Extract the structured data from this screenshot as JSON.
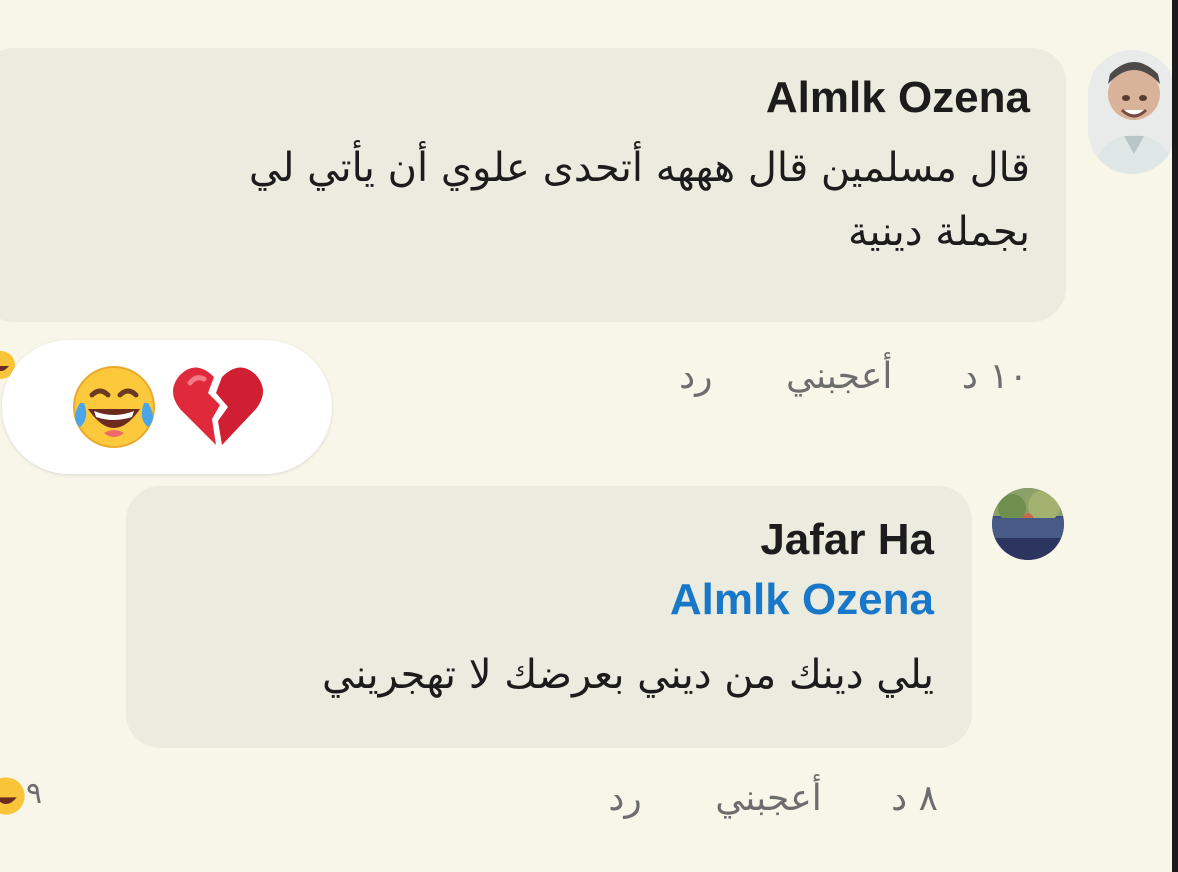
{
  "comments": [
    {
      "author": "Almlk Ozena",
      "avatar_icon": "person-photo-icon",
      "text_line1": "قال مسلمين قال هههه أتحدى علوي أن يأتي لي",
      "text_line2": "بجملة دينية",
      "time": "١٠ د",
      "like_label": "أعجبني",
      "reply_label": "رد",
      "reactions": [
        "laughing-tears-icon",
        "broken-heart-icon"
      ]
    },
    {
      "author": "Jafar Ha",
      "avatar_icon": "nature-photo-icon",
      "mention": "Almlk Ozena",
      "text": "يلي دينك من ديني بعرضك لا تهجريني",
      "time": "٨ د",
      "like_label": "أعجبني",
      "reply_label": "رد",
      "reaction_icon": "laughing-tears-icon",
      "reaction_count": "٩"
    }
  ],
  "colors": {
    "background": "#f7f6e9",
    "bubble": "#ebecdf",
    "mention": "#1877c8",
    "meta_text": "#6d6d6d"
  }
}
